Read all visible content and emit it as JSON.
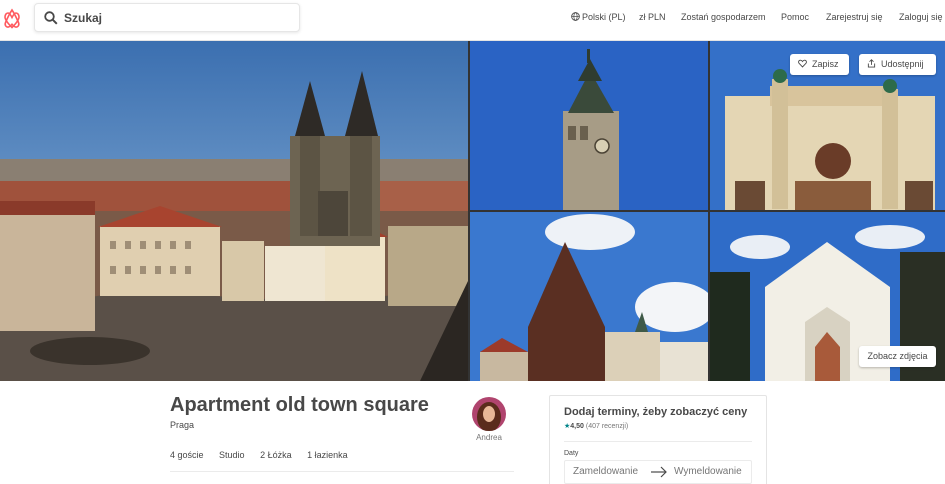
{
  "header": {
    "logo_icon": "airbnb-logo-icon",
    "search": {
      "placeholder": "Szukaj",
      "icon": "search-icon"
    },
    "nav": {
      "language": "Polski (PL)",
      "currency": "zł PLN",
      "host": "Zostań gospodarzem",
      "help": "Pomoc",
      "signup": "Zarejestruj się",
      "login": "Zaloguj się"
    }
  },
  "gallery": {
    "save_label": "Zapisz",
    "share_label": "Udostępnij",
    "view_photos_label": "Zobacz zdjęcia"
  },
  "listing": {
    "title": "Apartment old town square",
    "city": "Praga",
    "host_name": "Andrea",
    "specs": [
      "4 goście",
      "Studio",
      "2 Łóżka",
      "1 łazienka"
    ]
  },
  "booking": {
    "title": "Dodaj terminy, żeby zobaczyć ceny",
    "rating_score": "4,50",
    "rating_reviews": "(407 recenzji)",
    "dates_label": "Daty",
    "checkin_placeholder": "Zameldowanie",
    "checkout_placeholder": "Wymeldowanie"
  },
  "colors": {
    "brand": "#FF5A5F",
    "text": "#484848",
    "muted": "#767676",
    "star": "#008489"
  }
}
